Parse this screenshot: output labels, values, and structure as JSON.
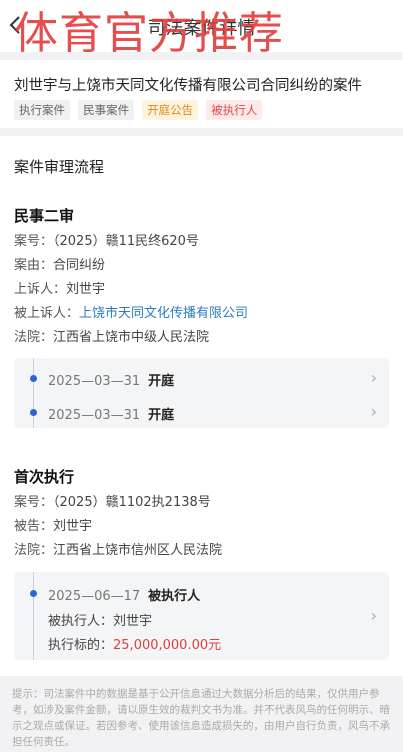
{
  "overlay_text": "体育官方推荐",
  "nav": {
    "title": "司法案件详情",
    "back_icon": "chevron-left-icon"
  },
  "case": {
    "title": "刘世宇与上饶市天同文化传播有限公司合同纠纷的案件",
    "tags": [
      {
        "label": "执行案件",
        "style": "gray"
      },
      {
        "label": "民事案件",
        "style": "gray"
      },
      {
        "label": "开庭公告",
        "style": "orange"
      },
      {
        "label": "被执行人",
        "style": "red"
      }
    ]
  },
  "process": {
    "section_title": "案件审理流程",
    "stage1": {
      "title": "民事二审",
      "rows": [
        {
          "label": "案号：",
          "value": "（2025）赣11民终620号"
        },
        {
          "label": "案由：",
          "value": "合同纠纷"
        },
        {
          "label": "上诉人：",
          "value": "刘世宇"
        },
        {
          "label": "被上诉人：",
          "value": "上饶市天同文化传播有限公司"
        },
        {
          "label": "法院：",
          "value": "江西省上饶市中级人民法院"
        }
      ],
      "events": [
        {
          "date": "2025—03—31",
          "event": "开庭"
        },
        {
          "date": "2025—03—31",
          "event": "开庭"
        }
      ]
    },
    "stage2": {
      "title": "首次执行",
      "rows": [
        {
          "label": "案号：",
          "value": "（2025）赣1102执2138号"
        },
        {
          "label": "被告：",
          "value": "刘世宇"
        },
        {
          "label": "法院：",
          "value": "江西省上饶市信州区人民法院"
        }
      ],
      "event": {
        "date": "2025—06—17",
        "event": "被执行人",
        "person_label": "被执行人：",
        "person": "刘世宇",
        "amount_label": "执行标的：",
        "amount": "25,000,000.00元"
      }
    }
  },
  "notice": "提示：司法案件中的数据是基于公开信息通过大数据分析后的结果，仅供用户参考，如涉及案件金额，请以原生效的裁判文书为准。并不代表风鸟的任何明示、暗示之观点或保证。若因参考、使用该信息造成损失的，由用户自行负责，风鸟不承担任何责任。",
  "colors": {
    "accent": "#2f64d6",
    "amount": "#e04040",
    "link": "#2a7bc9",
    "overlay": "#e23b3b"
  }
}
